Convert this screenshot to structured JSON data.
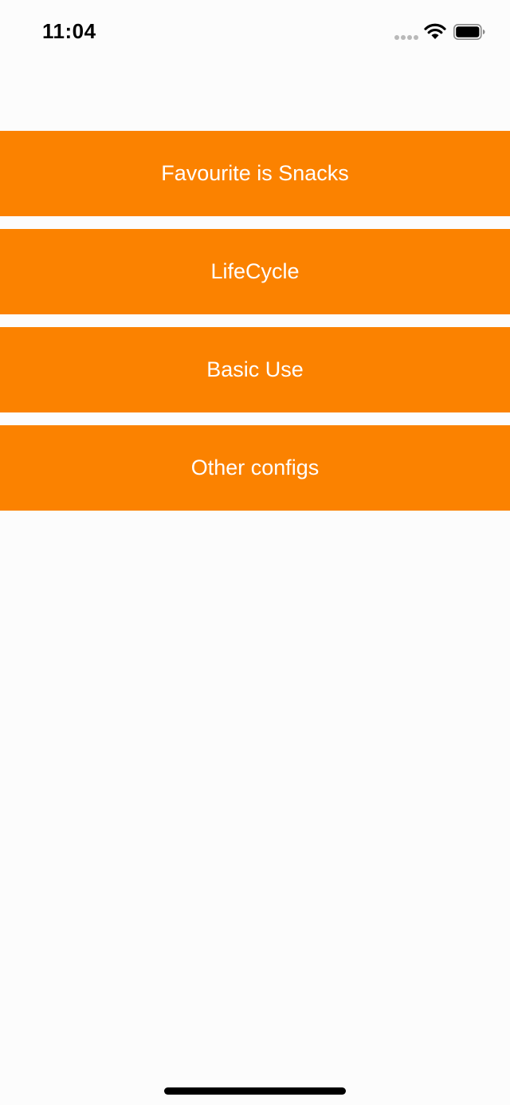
{
  "status_bar": {
    "time": "11:04"
  },
  "icons": {
    "signal": "cellular-signal-icon",
    "wifi": "wifi-icon",
    "battery": "battery-icon"
  },
  "colors": {
    "accent": "#fb8200",
    "background": "#fcfcfc",
    "button_text": "#ffffff"
  },
  "menu": {
    "items": [
      {
        "label": "Favourite is Snacks"
      },
      {
        "label": "LifeCycle"
      },
      {
        "label": "Basic Use"
      },
      {
        "label": "Other configs"
      }
    ]
  }
}
